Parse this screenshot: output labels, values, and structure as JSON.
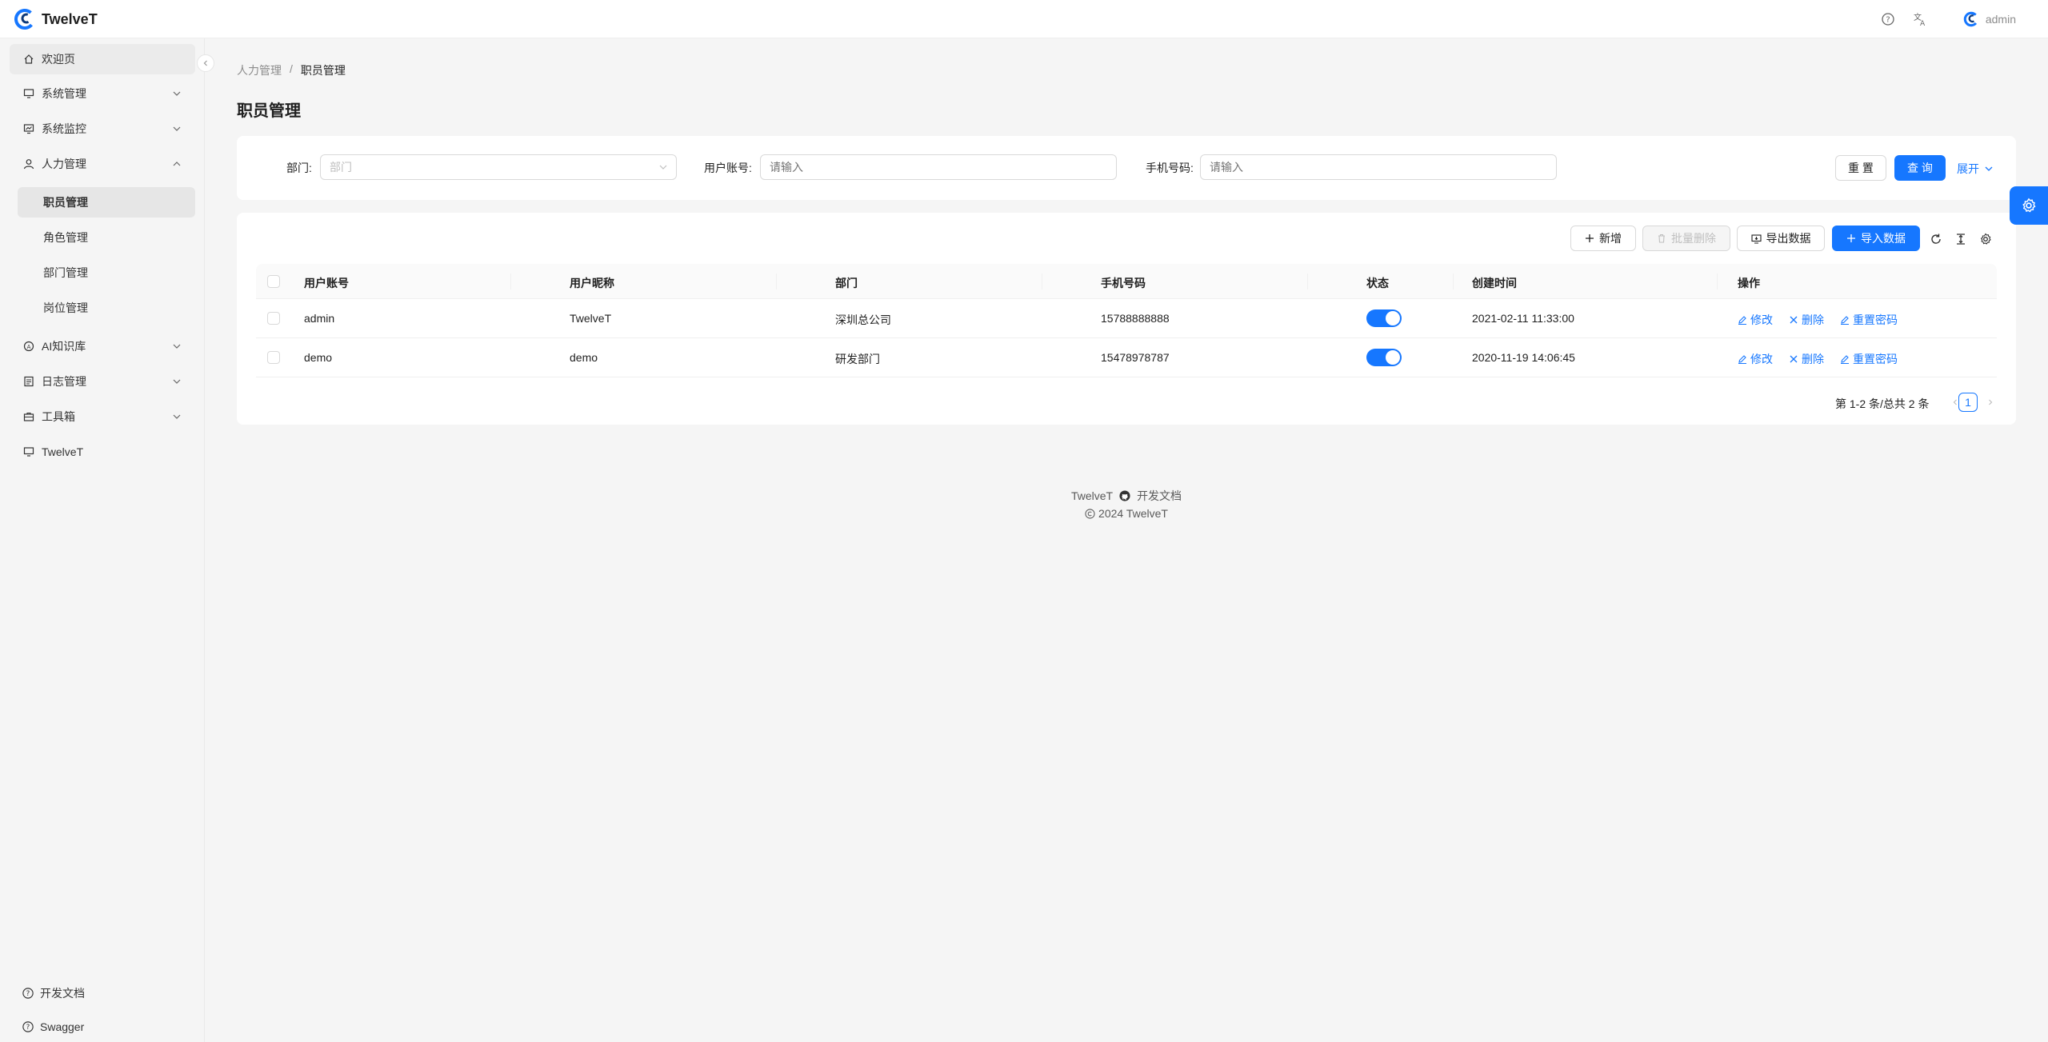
{
  "app": {
    "name": "TwelveT"
  },
  "header": {
    "user_name": "admin",
    "icons": [
      "help-icon",
      "translate-icon"
    ]
  },
  "sidebar": {
    "items": [
      {
        "label": "欢迎页",
        "icon": "home-icon",
        "active": true
      },
      {
        "label": "系统管理",
        "icon": "desktop-icon",
        "expandable": true
      },
      {
        "label": "系统监控",
        "icon": "fund-icon",
        "expandable": true
      },
      {
        "label": "人力管理",
        "icon": "user-icon",
        "expanded": true
      },
      {
        "label": "AI知识库",
        "icon": "ai-icon",
        "expandable": true
      },
      {
        "label": "日志管理",
        "icon": "log-icon",
        "expandable": true
      },
      {
        "label": "工具箱",
        "icon": "toolbox-icon",
        "expandable": true
      },
      {
        "label": "TwelveT",
        "icon": "desktop-icon"
      }
    ],
    "sub_items": [
      "职员管理",
      "角色管理",
      "部门管理",
      "岗位管理"
    ],
    "bottom": [
      {
        "label": "开发文档",
        "icon": "question-icon"
      },
      {
        "label": "Swagger",
        "icon": "question-icon"
      }
    ]
  },
  "breadcrumb": {
    "parent": "人力管理",
    "separator": "/",
    "current": "职员管理"
  },
  "page": {
    "title": "职员管理"
  },
  "search": {
    "dept_label": "部门:",
    "dept_placeholder": "部门",
    "account_label": "用户账号:",
    "account_placeholder": "请输入",
    "phone_label": "手机号码:",
    "phone_placeholder": "请输入",
    "reset_label": "重 置",
    "query_label": "查 询",
    "expand_label": "展开"
  },
  "toolbar": {
    "add_label": "新增",
    "batch_delete_label": "批量删除",
    "export_label": "导出数据",
    "import_label": "导入数据"
  },
  "table": {
    "columns": [
      "用户账号",
      "用户昵称",
      "部门",
      "手机号码",
      "状态",
      "创建时间",
      "操作"
    ],
    "rows": [
      {
        "account": "admin",
        "nickname": "TwelveT",
        "dept": "深圳总公司",
        "phone": "15788888888",
        "status": true,
        "created": "2021-02-11 11:33:00"
      },
      {
        "account": "demo",
        "nickname": "demo",
        "dept": "研发部门",
        "phone": "15478978787",
        "status": true,
        "created": "2020-11-19 14:06:45"
      }
    ],
    "actions": {
      "edit": "修改",
      "delete": "删除",
      "reset_pwd": "重置密码"
    }
  },
  "pagination": {
    "total_text": "第 1-2 条/总共 2 条",
    "current_page": "1"
  },
  "footer": {
    "brand": "TwelveT",
    "docs": "开发文档",
    "copyright": "2024 TwelveT"
  },
  "colors": {
    "primary": "#1677ff"
  }
}
